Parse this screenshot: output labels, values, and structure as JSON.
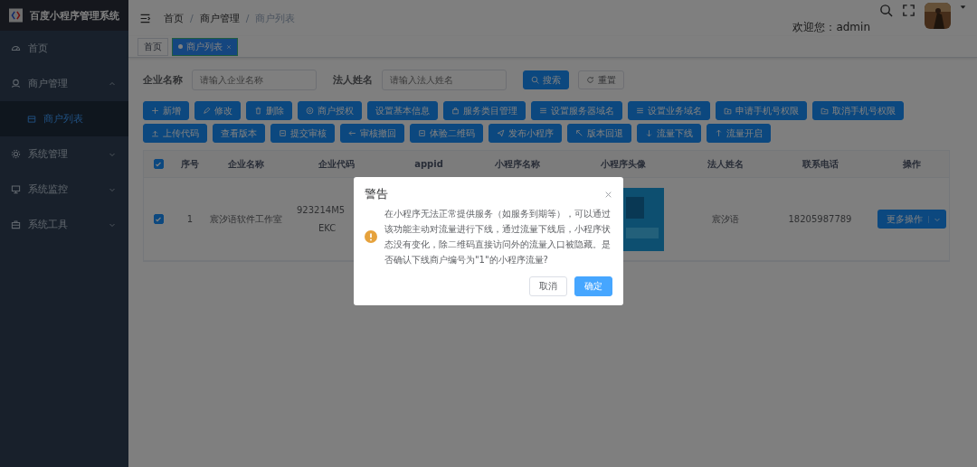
{
  "sidebar": {
    "title": "百度小程序管理系统",
    "items": [
      {
        "label": "首页",
        "kind": "home",
        "selected": false
      },
      {
        "label": "商户管理",
        "kind": "merchant",
        "selected": false,
        "expanded": true,
        "children": [
          {
            "label": "商户列表",
            "selected": true
          }
        ]
      },
      {
        "label": "系统管理",
        "kind": "settings",
        "selected": false,
        "expanded": false
      },
      {
        "label": "系统监控",
        "kind": "monitor",
        "selected": false,
        "expanded": false
      },
      {
        "label": "系统工具",
        "kind": "tools",
        "selected": false,
        "expanded": false
      }
    ]
  },
  "breadcrumb": [
    "首页",
    "商户管理",
    "商户列表"
  ],
  "breadcrumb_separator": "/",
  "user": {
    "welcome": "欢迎您：admin"
  },
  "tags": [
    {
      "label": "首页",
      "selected": false
    },
    {
      "label": "商户列表",
      "selected": true
    }
  ],
  "search": {
    "fields": [
      {
        "label": "企业名称",
        "placeholder": "请输入企业名称"
      },
      {
        "label": "法人姓名",
        "placeholder": "请输入法人姓名"
      }
    ],
    "search_button": "搜索",
    "reset_button": "重置"
  },
  "toolbar": [
    [
      "新增",
      "修改",
      "删除",
      "商户授权",
      "设置基本信息",
      "服务类目管理",
      "设置服务器域名",
      "设置业务域名",
      "申请手机号权限",
      "取消手机号权限"
    ],
    [
      "上传代码",
      "查看版本",
      "提交审核",
      "审核撤回",
      "体验二维码",
      "发布小程序",
      "版本回退",
      "流量下线",
      "流量开启"
    ]
  ],
  "table": {
    "all_checked": true,
    "columns": [
      "序号",
      "企业名称",
      "企业代码",
      "appid",
      "小程序名称",
      "小程序头像",
      "法人姓名",
      "联系电话",
      "操作"
    ],
    "rows": [
      {
        "checked": true,
        "index": "1",
        "company": "宸汐语软件工作室",
        "code": [
          "923214M5",
          "EKC"
        ],
        "legal_person": "宸汐语",
        "phone": "18205987789",
        "action": "更多操作"
      }
    ]
  },
  "dialog": {
    "title": "警告",
    "message": "在小程序无法正常提供服务（如服务到期等），可以通过该功能主动对流量进行下线，通过流量下线后，小程序状态没有变化，除二维码直接访问外的流量入口被隐藏。是否确认下线商户编号为\"1\"的小程序流量?",
    "cancel": "取消",
    "confirm": "确定"
  }
}
